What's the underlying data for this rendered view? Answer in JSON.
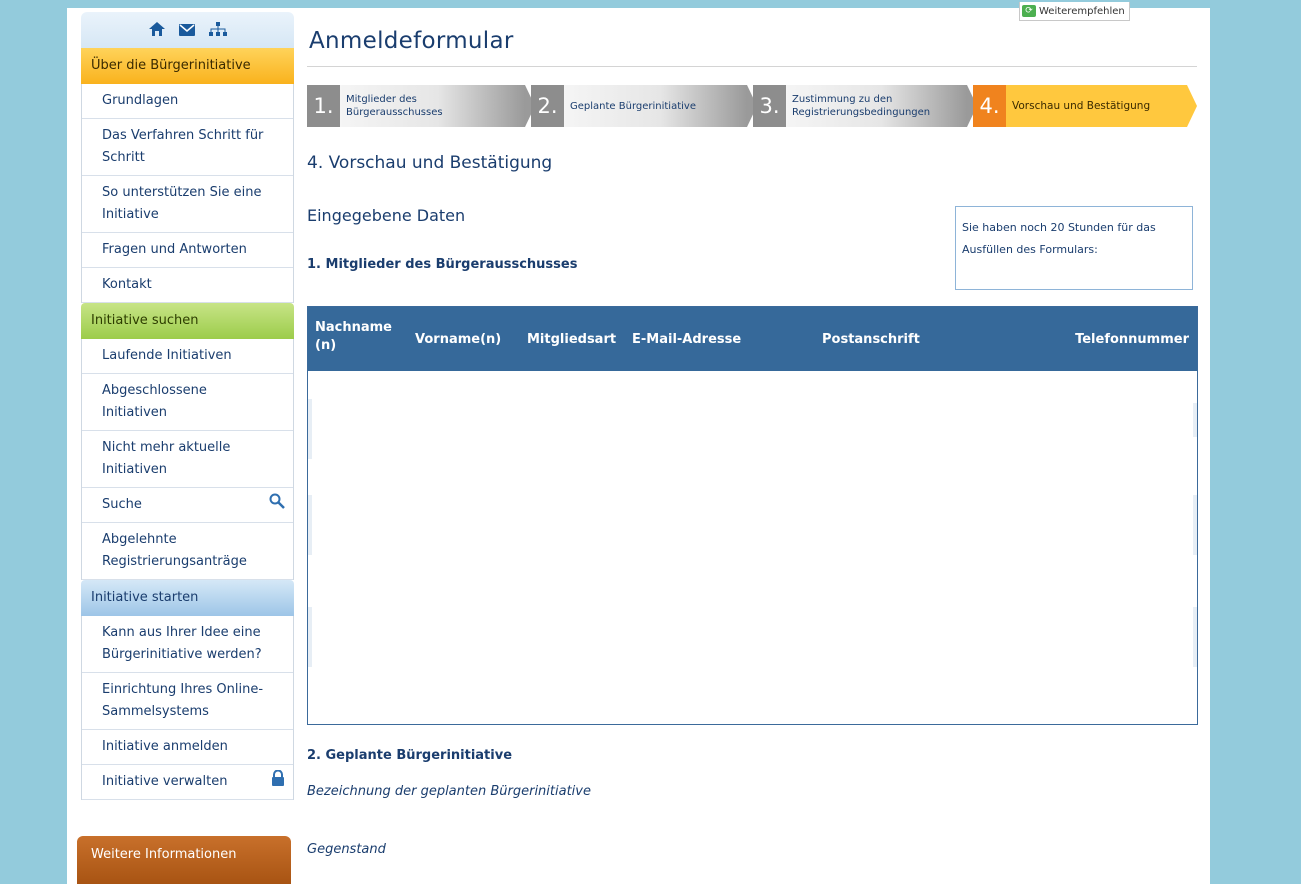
{
  "share": {
    "label": "Weiterempfehlen"
  },
  "sidebar": {
    "icons": [
      "home-icon",
      "mail-icon",
      "sitemap-icon"
    ],
    "section1": {
      "title": "Über die Bürgerinitiative",
      "items": [
        "Grundlagen",
        "Das Verfahren Schritt für Schritt",
        "So unterstützen Sie eine Initiative",
        "Fragen und Antworten",
        "Kontakt"
      ]
    },
    "section2": {
      "title": "Initiative suchen",
      "items": [
        "Laufende Initiativen",
        "Abgeschlossene Initiativen",
        "Nicht mehr aktuelle Initiativen",
        "Suche",
        "Abgelehnte Registrierungsanträge"
      ]
    },
    "section3": {
      "title": "Initiative starten",
      "items": [
        "Kann aus Ihrer Idee eine Bürgerinitiative werden?",
        "Einrichtung Ihres Online-Sammelsystems",
        "Initiative anmelden",
        "Initiative verwalten"
      ]
    },
    "further": "Weitere Informationen"
  },
  "main": {
    "title": "Anmeldeformular",
    "steps": [
      {
        "num": "1.",
        "label": "Mitglieder des Bürgerausschusses"
      },
      {
        "num": "2.",
        "label": "Geplante Bürgerinitiative"
      },
      {
        "num": "3.",
        "label": "Zustimmung zu den Registrierungsbedingungen"
      },
      {
        "num": "4.",
        "label": "Vorschau und Bestätigung"
      }
    ],
    "heading": "4. Vorschau und Bestätigung",
    "subheading": "Eingegebene Daten",
    "timer_text": "Sie haben noch 20 Stunden für das Ausfüllen des Formulars:",
    "section1_title": "1. Mitglieder des Bürgerausschusses",
    "table_headers": [
      "Nachname (n)",
      "Vorname(n)",
      "Mitgliedsart",
      "E-Mail-Adresse",
      "Postanschrift",
      "Telefonnummer"
    ],
    "section2_title": "2. Geplante Bürgerinitiative",
    "field1_label": "Bezeichnung der geplanten Bürgerinitiative",
    "field2_label": "Gegenstand"
  }
}
